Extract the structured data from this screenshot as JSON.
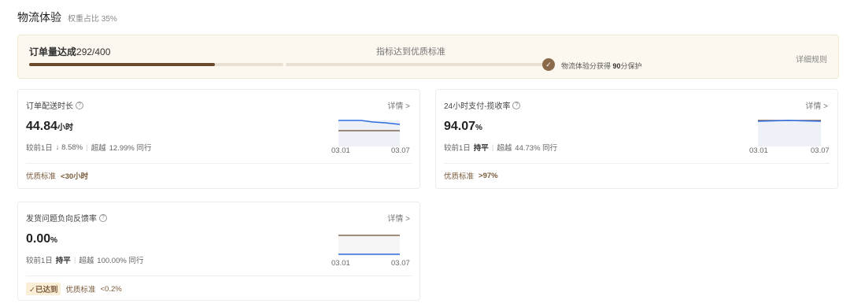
{
  "header": {
    "title": "物流体验",
    "weight": "权重占比 35%"
  },
  "progress": {
    "label": "订单量达成",
    "count": "292/400",
    "fraction": 0.73,
    "center": "指标达到优质标准",
    "note_prefix": "物流体验分获得",
    "note_score": "90",
    "note_suffix": "分保护",
    "rule_link": "详细规则",
    "colors": {
      "fill": "#6b4a2b",
      "track": "#e8e0d3"
    }
  },
  "cards": [
    {
      "title": "订单配送时长",
      "detail": "详情 >",
      "value": "44.84",
      "unit": "小时",
      "compare_label": "较前1日",
      "compare_value": "↓ 8.58%",
      "beat_label": "超越",
      "beat_value": "12.99% 同行",
      "standard_label": "优质标准",
      "standard_value": "<30小时",
      "tick_start": "03.01",
      "tick_end": "03.07"
    },
    {
      "title": "24小时支付-揽收率",
      "detail": "详情 >",
      "value": "94.07",
      "unit": "%",
      "compare_label": "较前1日",
      "compare_value": "持平",
      "beat_label": "超越",
      "beat_value": "44.73% 同行",
      "standard_label": "优质标准",
      "standard_value": ">97%",
      "tick_start": "03.01",
      "tick_end": "03.07"
    },
    {
      "title": "发货问题负向反馈率",
      "detail": "详情 >",
      "value": "0.00",
      "unit": "%",
      "compare_label": "较前1日",
      "compare_value": "持平",
      "beat_label": "超越",
      "beat_value": "100.00% 同行",
      "reached": "✓已达到",
      "standard_label": "优质标准",
      "standard_value": "<0.2%",
      "tick_start": "03.01",
      "tick_end": "03.07"
    }
  ]
}
